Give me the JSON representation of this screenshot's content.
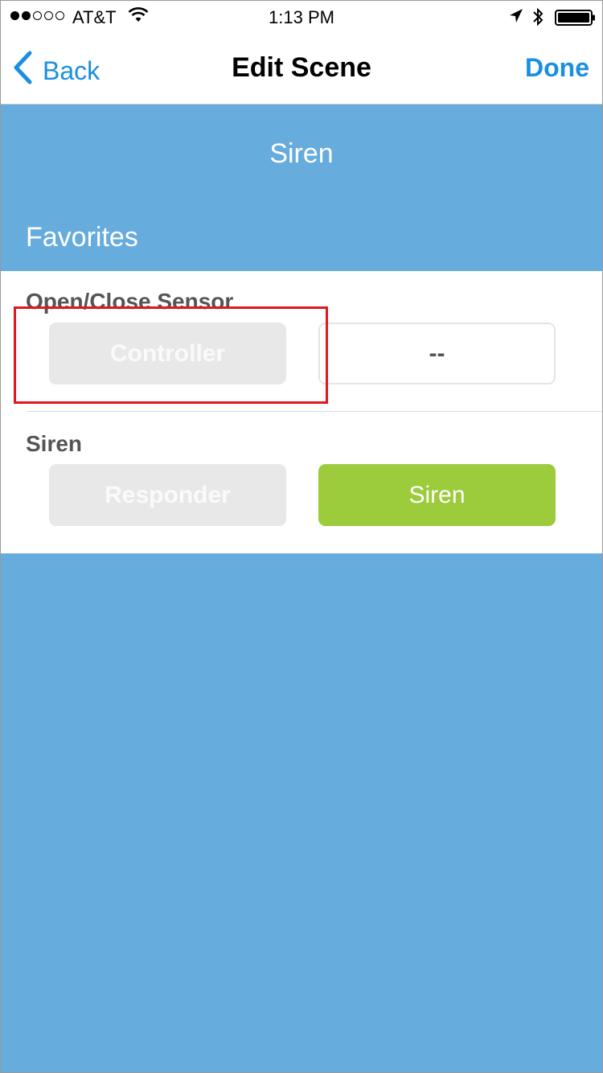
{
  "status_bar": {
    "carrier": "AT&T",
    "time": "1:13 PM",
    "signal_bars_filled": 2,
    "signal_bars_total": 5,
    "icons": [
      "wifi-icon",
      "location-arrow-icon",
      "bluetooth-icon",
      "battery-icon"
    ]
  },
  "nav": {
    "back_label": "Back",
    "title": "Edit Scene",
    "done_label": "Done"
  },
  "scene": {
    "name": "Siren",
    "section_title": "Favorites"
  },
  "devices": [
    {
      "name": "Open/Close Sensor",
      "role_label": "Controller",
      "state_label": "--"
    },
    {
      "name": "Siren",
      "role_label": "Responder",
      "state_label": "Siren"
    }
  ],
  "colors": {
    "accent": "#1a8fe0",
    "background_blue": "#66acdc",
    "active_green": "#9ccb3c",
    "highlight_red": "#e3161d"
  }
}
